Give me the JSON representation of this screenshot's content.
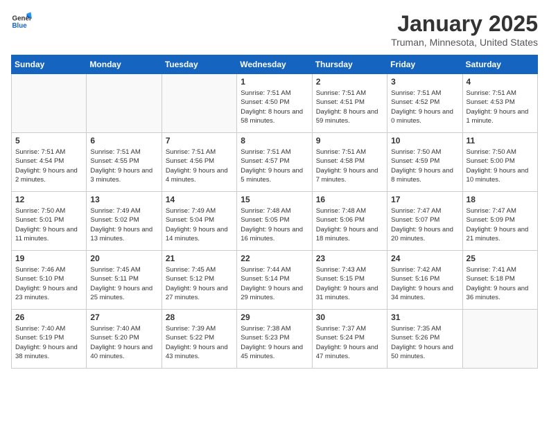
{
  "header": {
    "logo_general": "General",
    "logo_blue": "Blue",
    "month": "January 2025",
    "location": "Truman, Minnesota, United States"
  },
  "weekdays": [
    "Sunday",
    "Monday",
    "Tuesday",
    "Wednesday",
    "Thursday",
    "Friday",
    "Saturday"
  ],
  "weeks": [
    [
      {
        "day": "",
        "info": ""
      },
      {
        "day": "",
        "info": ""
      },
      {
        "day": "",
        "info": ""
      },
      {
        "day": "1",
        "info": "Sunrise: 7:51 AM\nSunset: 4:50 PM\nDaylight: 8 hours\nand 58 minutes."
      },
      {
        "day": "2",
        "info": "Sunrise: 7:51 AM\nSunset: 4:51 PM\nDaylight: 8 hours\nand 59 minutes."
      },
      {
        "day": "3",
        "info": "Sunrise: 7:51 AM\nSunset: 4:52 PM\nDaylight: 9 hours\nand 0 minutes."
      },
      {
        "day": "4",
        "info": "Sunrise: 7:51 AM\nSunset: 4:53 PM\nDaylight: 9 hours\nand 1 minute."
      }
    ],
    [
      {
        "day": "5",
        "info": "Sunrise: 7:51 AM\nSunset: 4:54 PM\nDaylight: 9 hours\nand 2 minutes."
      },
      {
        "day": "6",
        "info": "Sunrise: 7:51 AM\nSunset: 4:55 PM\nDaylight: 9 hours\nand 3 minutes."
      },
      {
        "day": "7",
        "info": "Sunrise: 7:51 AM\nSunset: 4:56 PM\nDaylight: 9 hours\nand 4 minutes."
      },
      {
        "day": "8",
        "info": "Sunrise: 7:51 AM\nSunset: 4:57 PM\nDaylight: 9 hours\nand 5 minutes."
      },
      {
        "day": "9",
        "info": "Sunrise: 7:51 AM\nSunset: 4:58 PM\nDaylight: 9 hours\nand 7 minutes."
      },
      {
        "day": "10",
        "info": "Sunrise: 7:50 AM\nSunset: 4:59 PM\nDaylight: 9 hours\nand 8 minutes."
      },
      {
        "day": "11",
        "info": "Sunrise: 7:50 AM\nSunset: 5:00 PM\nDaylight: 9 hours\nand 10 minutes."
      }
    ],
    [
      {
        "day": "12",
        "info": "Sunrise: 7:50 AM\nSunset: 5:01 PM\nDaylight: 9 hours\nand 11 minutes."
      },
      {
        "day": "13",
        "info": "Sunrise: 7:49 AM\nSunset: 5:02 PM\nDaylight: 9 hours\nand 13 minutes."
      },
      {
        "day": "14",
        "info": "Sunrise: 7:49 AM\nSunset: 5:04 PM\nDaylight: 9 hours\nand 14 minutes."
      },
      {
        "day": "15",
        "info": "Sunrise: 7:48 AM\nSunset: 5:05 PM\nDaylight: 9 hours\nand 16 minutes."
      },
      {
        "day": "16",
        "info": "Sunrise: 7:48 AM\nSunset: 5:06 PM\nDaylight: 9 hours\nand 18 minutes."
      },
      {
        "day": "17",
        "info": "Sunrise: 7:47 AM\nSunset: 5:07 PM\nDaylight: 9 hours\nand 20 minutes."
      },
      {
        "day": "18",
        "info": "Sunrise: 7:47 AM\nSunset: 5:09 PM\nDaylight: 9 hours\nand 21 minutes."
      }
    ],
    [
      {
        "day": "19",
        "info": "Sunrise: 7:46 AM\nSunset: 5:10 PM\nDaylight: 9 hours\nand 23 minutes."
      },
      {
        "day": "20",
        "info": "Sunrise: 7:45 AM\nSunset: 5:11 PM\nDaylight: 9 hours\nand 25 minutes."
      },
      {
        "day": "21",
        "info": "Sunrise: 7:45 AM\nSunset: 5:12 PM\nDaylight: 9 hours\nand 27 minutes."
      },
      {
        "day": "22",
        "info": "Sunrise: 7:44 AM\nSunset: 5:14 PM\nDaylight: 9 hours\nand 29 minutes."
      },
      {
        "day": "23",
        "info": "Sunrise: 7:43 AM\nSunset: 5:15 PM\nDaylight: 9 hours\nand 31 minutes."
      },
      {
        "day": "24",
        "info": "Sunrise: 7:42 AM\nSunset: 5:16 PM\nDaylight: 9 hours\nand 34 minutes."
      },
      {
        "day": "25",
        "info": "Sunrise: 7:41 AM\nSunset: 5:18 PM\nDaylight: 9 hours\nand 36 minutes."
      }
    ],
    [
      {
        "day": "26",
        "info": "Sunrise: 7:40 AM\nSunset: 5:19 PM\nDaylight: 9 hours\nand 38 minutes."
      },
      {
        "day": "27",
        "info": "Sunrise: 7:40 AM\nSunset: 5:20 PM\nDaylight: 9 hours\nand 40 minutes."
      },
      {
        "day": "28",
        "info": "Sunrise: 7:39 AM\nSunset: 5:22 PM\nDaylight: 9 hours\nand 43 minutes."
      },
      {
        "day": "29",
        "info": "Sunrise: 7:38 AM\nSunset: 5:23 PM\nDaylight: 9 hours\nand 45 minutes."
      },
      {
        "day": "30",
        "info": "Sunrise: 7:37 AM\nSunset: 5:24 PM\nDaylight: 9 hours\nand 47 minutes."
      },
      {
        "day": "31",
        "info": "Sunrise: 7:35 AM\nSunset: 5:26 PM\nDaylight: 9 hours\nand 50 minutes."
      },
      {
        "day": "",
        "info": ""
      }
    ]
  ]
}
